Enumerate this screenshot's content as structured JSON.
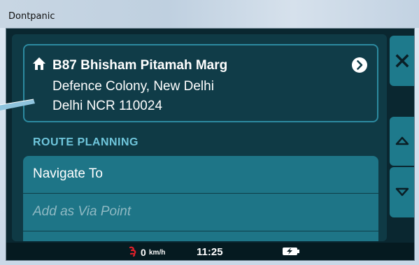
{
  "window": {
    "title": "Dontpanic"
  },
  "destination": {
    "name": "B87 Bhisham Pitamah Marg",
    "line1": "Defence Colony, New Delhi",
    "line2": "Delhi NCR 110024"
  },
  "route_planning": {
    "header": "ROUTE PLANNING",
    "items": [
      {
        "label": "Navigate To",
        "enabled": true
      },
      {
        "label": "Add as Via Point",
        "enabled": false
      }
    ]
  },
  "side_buttons": {
    "close": "close-icon",
    "scroll_up": "chevron-up-icon",
    "scroll_down": "chevron-down-icon"
  },
  "status": {
    "speed_value": "0",
    "speed_unit": "km/h",
    "time": "11:25"
  },
  "colors": {
    "accent": "#6fc6dc",
    "panel": "#0f3a45",
    "menu": "#1e7587",
    "speed_icon": "#e0202a"
  }
}
